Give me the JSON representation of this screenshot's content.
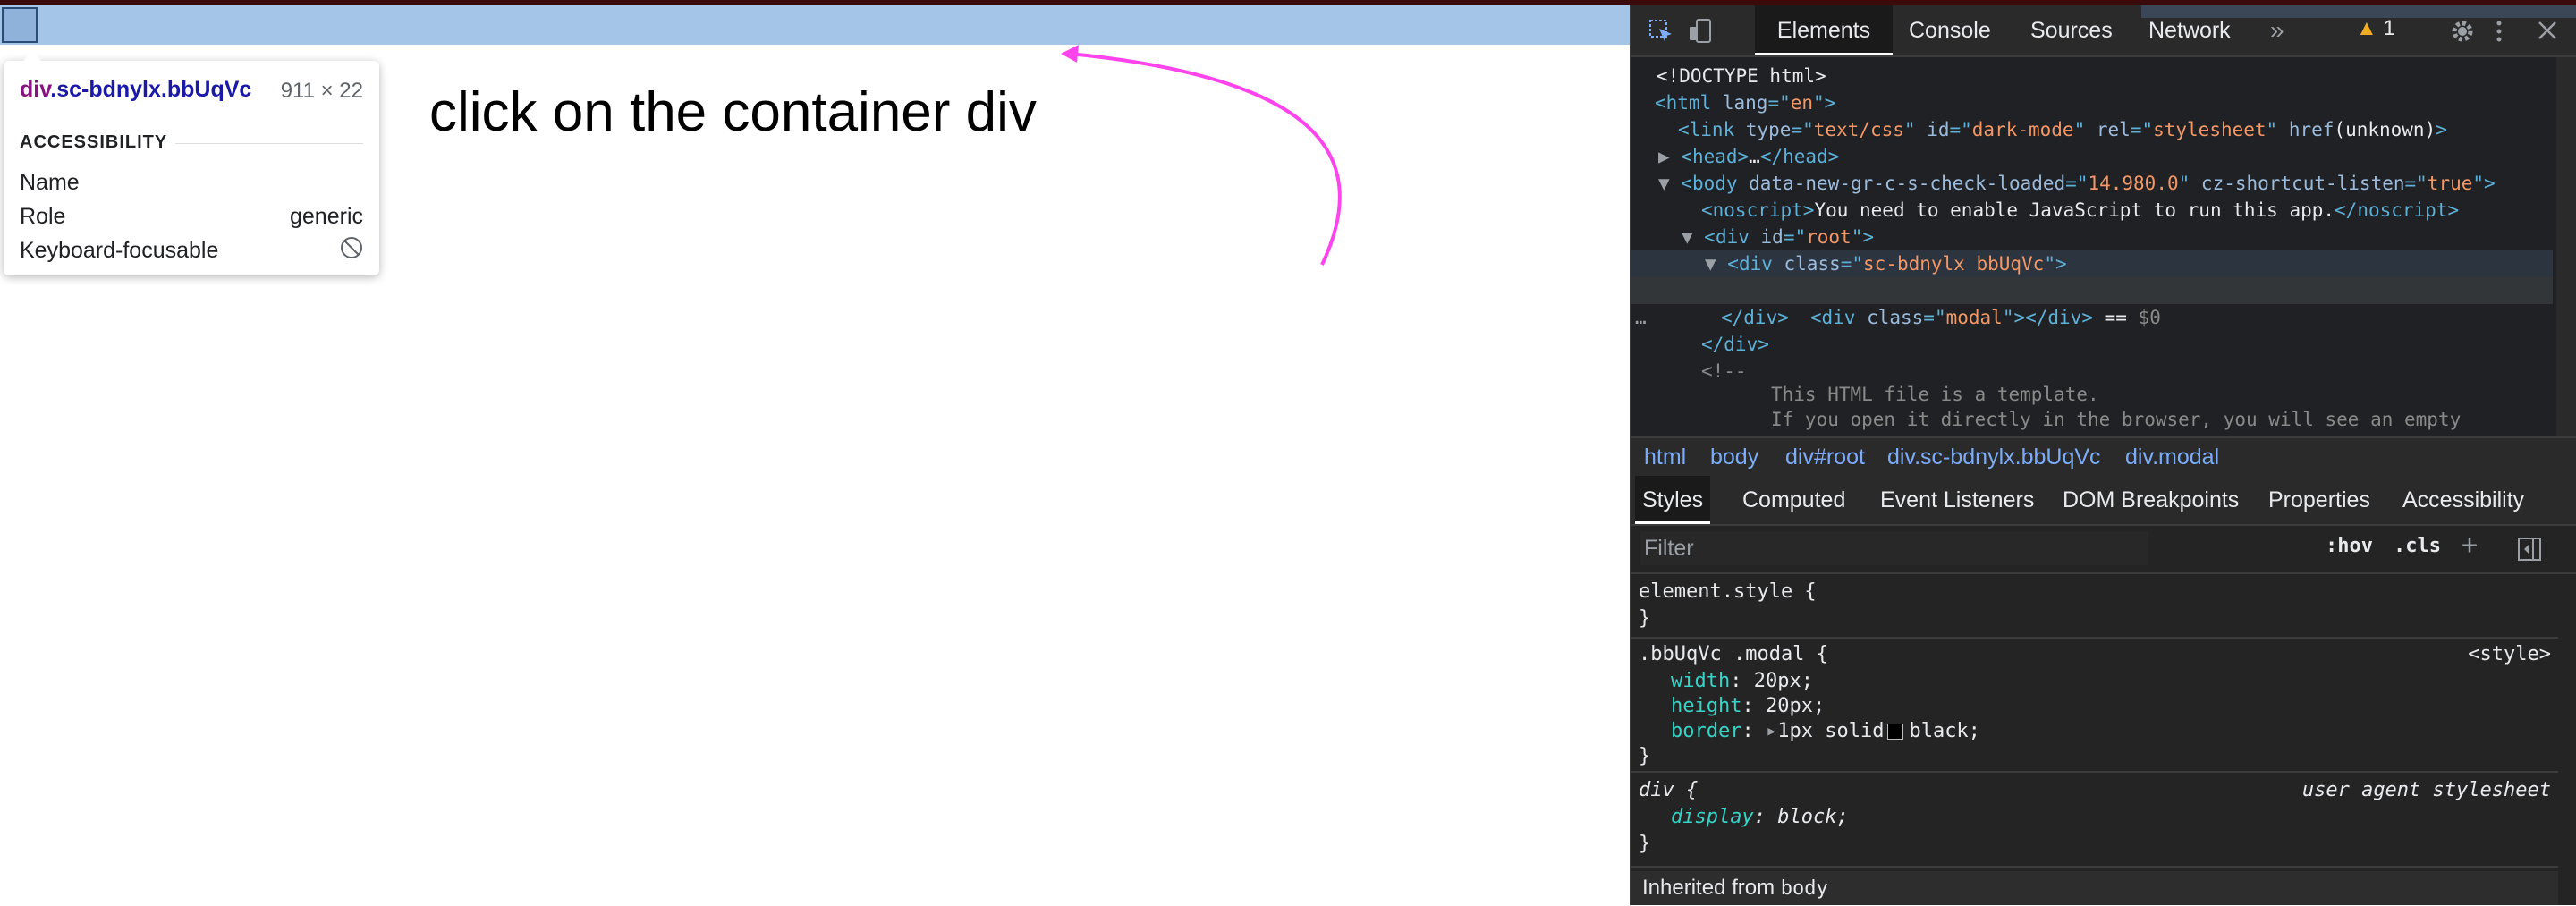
{
  "page": {
    "tooltip": {
      "tag": "div",
      "class_name": ".sc-bdnylx.bbUqVc",
      "size": "911 × 22",
      "section_title": "ACCESSIBILITY",
      "rows": [
        {
          "key": "Name",
          "value": ""
        },
        {
          "key": "Role",
          "value": "generic"
        },
        {
          "key": "Keyboard-focusable",
          "value": ""
        }
      ]
    },
    "annotation": "click on the container div",
    "annotation_color": "#ff44ee"
  },
  "devtools": {
    "tabs": [
      "Elements",
      "Console",
      "Sources",
      "Network"
    ],
    "more_tabs": "»",
    "warnings_count": "1",
    "dom_lines": [
      {
        "parts": [
          {
            "c": "tx",
            "t": "<!DOCTYPE html>"
          }
        ]
      },
      {
        "parts": [
          {
            "c": "tn",
            "t": "<html "
          },
          {
            "c": "an",
            "t": "lang"
          },
          {
            "c": "tn",
            "t": "=\""
          },
          {
            "c": "av",
            "t": "en"
          },
          {
            "c": "tn",
            "t": "\">"
          }
        ]
      },
      {
        "parts": [
          {
            "c": "tn",
            "t": "<link "
          },
          {
            "c": "an",
            "t": "type"
          },
          {
            "c": "tn",
            "t": "=\""
          },
          {
            "c": "av",
            "t": "text/css"
          },
          {
            "c": "tn",
            "t": "\" "
          },
          {
            "c": "an",
            "t": "id"
          },
          {
            "c": "tn",
            "t": "=\""
          },
          {
            "c": "av",
            "t": "dark-mode"
          },
          {
            "c": "tn",
            "t": "\" "
          },
          {
            "c": "an",
            "t": "rel"
          },
          {
            "c": "tn",
            "t": "=\""
          },
          {
            "c": "av",
            "t": "stylesheet"
          },
          {
            "c": "tn",
            "t": "\" "
          },
          {
            "c": "an",
            "t": "href"
          },
          {
            "c": "tx",
            "t": "(unknown)"
          },
          {
            "c": "tn",
            "t": ">"
          }
        ]
      },
      {
        "parts": [
          {
            "c": "tn",
            "t": "<head>"
          },
          {
            "c": "tx",
            "t": "…"
          },
          {
            "c": "tn",
            "t": "</head>"
          }
        ]
      },
      {
        "parts": [
          {
            "c": "tn",
            "t": "<body "
          },
          {
            "c": "an",
            "t": "data-new-gr-c-s-check-loaded"
          },
          {
            "c": "tn",
            "t": "=\""
          },
          {
            "c": "av",
            "t": "14.980.0"
          },
          {
            "c": "tn",
            "t": "\" "
          },
          {
            "c": "an",
            "t": "cz-shortcut-listen"
          },
          {
            "c": "tn",
            "t": "=\""
          },
          {
            "c": "av",
            "t": "true"
          },
          {
            "c": "tn",
            "t": "\">"
          }
        ]
      },
      {
        "parts": [
          {
            "c": "tn",
            "t": "<noscript>"
          },
          {
            "c": "tx",
            "t": "You need to enable JavaScript to run this app."
          },
          {
            "c": "tn",
            "t": "</noscript>"
          }
        ]
      },
      {
        "parts": [
          {
            "c": "tn",
            "t": "<div "
          },
          {
            "c": "an",
            "t": "id"
          },
          {
            "c": "tn",
            "t": "=\""
          },
          {
            "c": "av",
            "t": "root"
          },
          {
            "c": "tn",
            "t": "\">"
          }
        ]
      },
      {
        "parts": [
          {
            "c": "tn",
            "t": "<div "
          },
          {
            "c": "an",
            "t": "class"
          },
          {
            "c": "tn",
            "t": "=\""
          },
          {
            "c": "av",
            "t": "sc-bdnylx bbUqVc"
          },
          {
            "c": "tn",
            "t": "\">"
          }
        ]
      },
      {
        "parts": [
          {
            "c": "tn",
            "t": "<div "
          },
          {
            "c": "an",
            "t": "class"
          },
          {
            "c": "tn",
            "t": "=\""
          },
          {
            "c": "av",
            "t": "modal"
          },
          {
            "c": "tn",
            "t": "\"></div>"
          },
          {
            "c": "tx",
            "t": " == "
          },
          {
            "c": "cm",
            "t": "$0"
          }
        ]
      },
      {
        "parts": [
          {
            "c": "tn",
            "t": "</div>"
          }
        ]
      },
      {
        "parts": [
          {
            "c": "tn",
            "t": "</div>"
          }
        ]
      },
      {
        "parts": [
          {
            "c": "cm",
            "t": "<!--"
          }
        ]
      },
      {
        "parts": [
          {
            "c": "cm",
            "t": "This HTML file is a template."
          }
        ]
      },
      {
        "parts": [
          {
            "c": "cm",
            "t": "If you open it directly in the browser, you will see an empty"
          }
        ]
      }
    ],
    "selected_marker": "…",
    "breadcrumbs": [
      "html",
      "body",
      "div#root",
      "div.sc-bdnylx.bbUqVc",
      "div.modal"
    ],
    "subtabs": [
      "Styles",
      "Computed",
      "Event Listeners",
      "DOM Breakpoints",
      "Properties",
      "Accessibility"
    ],
    "filter_placeholder": "Filter",
    "hov_label": ":hov",
    "cls_label": ".cls",
    "plus_label": "+",
    "rules": {
      "element_style": {
        "selector": "element.style {",
        "close": "}"
      },
      "modal": {
        "selector": ".bbUqVc .modal {",
        "origin": "<style>",
        "props": [
          {
            "name": "width",
            "value": "20px;"
          },
          {
            "name": "height",
            "value": "20px;"
          },
          {
            "name": "border",
            "value": "1px solid",
            "color_name": "black;"
          }
        ],
        "close": "}"
      },
      "div": {
        "selector": "div {",
        "origin": "user agent stylesheet",
        "props": [
          {
            "name": "display",
            "value": "block;"
          }
        ],
        "close": "}"
      }
    },
    "inherited_label": "Inherited from",
    "inherited_from": "body"
  }
}
